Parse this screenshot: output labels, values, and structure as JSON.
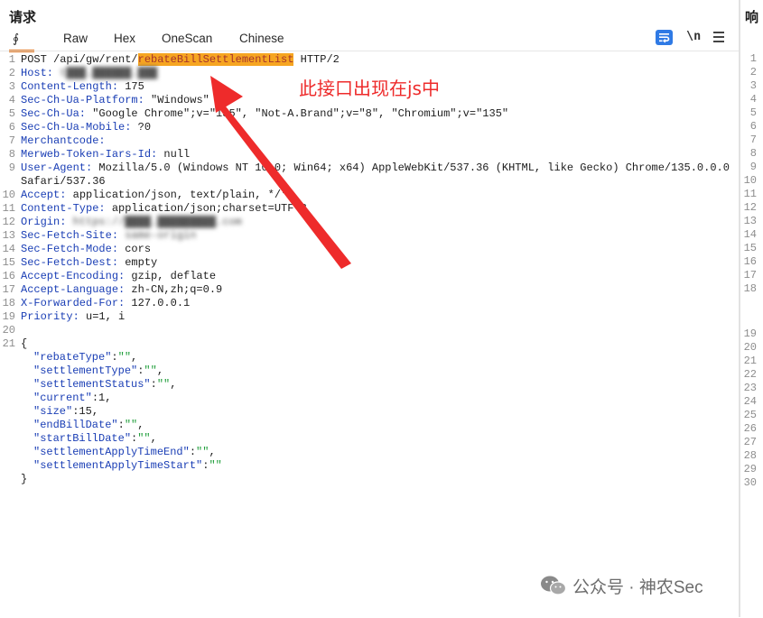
{
  "request_panel": {
    "title": "请求",
    "tabs": [
      {
        "label": "Pretty",
        "visible_text": "∮",
        "active": true
      },
      {
        "label": "Raw"
      },
      {
        "label": "Hex"
      },
      {
        "label": "OneScan"
      },
      {
        "label": "Chinese"
      }
    ],
    "tools": {
      "wrap_icon": "wrap-lines-icon",
      "newline_label": "\\n",
      "menu_icon": "hamburger-menu-icon"
    },
    "lines": [
      {
        "n": "1",
        "method": "POST /api/gw/rent/",
        "endpoint": "rebateBillSettlementList",
        "tail": " HTTP/2"
      },
      {
        "n": "2",
        "name": "Host:",
        "value": " t███.██████.███",
        "blurred": true
      },
      {
        "n": "3",
        "name": "Content-Length:",
        "value": " 175"
      },
      {
        "n": "4",
        "name": "Sec-Ch-Ua-Platform:",
        "value": " \"Windows\""
      },
      {
        "n": "5",
        "name": "Sec-Ch-Ua:",
        "value": " \"Google Chrome\";v=\"135\", \"Not-A.Brand\";v=\"8\", \"Chromium\";v=\"135\""
      },
      {
        "n": "6",
        "name": "Sec-Ch-Ua-Mobile:",
        "value": " ?0"
      },
      {
        "n": "7",
        "name": "Merchantcode:",
        "value": ""
      },
      {
        "n": "8",
        "name": "Merweb-Token-Iars-Id:",
        "value": " null"
      },
      {
        "n": "9",
        "name": "User-Agent:",
        "value": " Mozilla/5.0 (Windows NT 10.0; Win64; x64) AppleWebKit/537.36 (KHTML, like Gecko) Chrome/135.0.0.0"
      },
      {
        "n": "",
        "name": "",
        "value": "Safari/537.36"
      },
      {
        "n": "10",
        "name": "Accept:",
        "value": " application/json, text/plain, */*"
      },
      {
        "n": "11",
        "name": "Content-Type:",
        "value": " application/json;charset=UTF-8"
      },
      {
        "n": "12",
        "name": "Origin:",
        "value": " https://████.█████████.com",
        "blurred": true
      },
      {
        "n": "13",
        "name": "Sec-Fetch-Site:",
        "value": " same-origin",
        "blurred": true
      },
      {
        "n": "14",
        "name": "Sec-Fetch-Mode:",
        "value": " cors"
      },
      {
        "n": "15",
        "name": "Sec-Fetch-Dest:",
        "value": " empty"
      },
      {
        "n": "16",
        "name": "Accept-Encoding:",
        "value": " gzip, deflate"
      },
      {
        "n": "17",
        "name": "Accept-Language:",
        "value": " zh-CN,zh;q=0.9"
      },
      {
        "n": "18",
        "name": "X-Forwarded-For:",
        "value": " 127.0.0.1"
      },
      {
        "n": "19",
        "name": "Priority:",
        "value": " u=1, i"
      },
      {
        "n": "20",
        "name": "",
        "value": ""
      },
      {
        "n": "21",
        "name": "",
        "value": "{"
      }
    ],
    "json_body": [
      {
        "key": "\"rebateType\"",
        "sep": ":",
        "val": "\"\"",
        "type": "str",
        "end": ","
      },
      {
        "key": "\"settlementType\"",
        "sep": ":",
        "val": "\"\"",
        "type": "str",
        "end": ","
      },
      {
        "key": "\"settlementStatus\"",
        "sep": ":",
        "val": "\"\"",
        "type": "str",
        "end": ","
      },
      {
        "key": "\"current\"",
        "sep": ":",
        "val": "1",
        "type": "num",
        "end": ","
      },
      {
        "key": "\"size\"",
        "sep": ":",
        "val": "15",
        "type": "num",
        "end": ","
      },
      {
        "key": "\"endBillDate\"",
        "sep": ":",
        "val": "\"\"",
        "type": "str",
        "end": ","
      },
      {
        "key": "\"startBillDate\"",
        "sep": ":",
        "val": "\"\"",
        "type": "str",
        "end": ","
      },
      {
        "key": "\"settlementApplyTimeEnd\"",
        "sep": ":",
        "val": "\"\"",
        "type": "str",
        "end": ","
      },
      {
        "key": "\"settlementApplyTimeStart\"",
        "sep": ":",
        "val": "\"\"",
        "type": "str",
        "end": ""
      }
    ],
    "closing_brace": "}"
  },
  "annotation": {
    "text": "此接口出现在js中",
    "color": "#ee2b2b"
  },
  "response_panel": {
    "title": "响",
    "line_numbers": [
      "1",
      "2",
      "3",
      "4",
      "5",
      "6",
      "7",
      "8",
      "9",
      "10",
      "11",
      "12",
      "13",
      "14",
      "15",
      "16",
      "17",
      "18",
      "19",
      "20",
      "21",
      "22",
      "23",
      "24",
      "25",
      "26",
      "27",
      "28",
      "29",
      "30"
    ]
  },
  "watermark": {
    "text": "公众号 · 神农Sec",
    "icon": "wechat-icon"
  },
  "colors": {
    "header_name": "#1a3eb5",
    "highlight_bg": "#f6a521",
    "json_string": "#1f9e3a",
    "active_tab_underline": "#e0731b",
    "wrap_button": "#2f7ae5"
  }
}
